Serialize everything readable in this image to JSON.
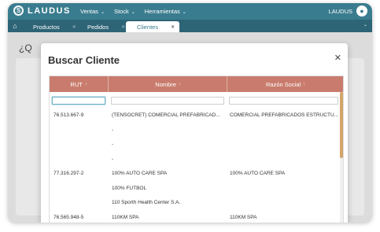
{
  "app": {
    "logo_text": "LAUDUS",
    "logo_mark": "S"
  },
  "menu": [
    {
      "label": "Ventas"
    },
    {
      "label": "Stock"
    },
    {
      "label": "Herramientas"
    }
  ],
  "user": {
    "name": "LAUDUS"
  },
  "tabs": [
    {
      "label": "Productos"
    },
    {
      "label": "Pedidos"
    },
    {
      "label": "Clientes"
    }
  ],
  "page": {
    "title": "¿Q"
  },
  "modal": {
    "title": "Buscar Cliente",
    "close_label": "✕",
    "columns": [
      "RUT",
      "Nombre",
      "Razón Social"
    ],
    "rows": [
      {
        "rut": "76.513.667-9",
        "nombre": "(TENSOCRET) COMERCIAL PREFABRICAD...",
        "razon": "COMERCIAL PREFABRICADOS ESTRUCTU..."
      },
      {
        "rut": "",
        "nombre": "-",
        "razon": ""
      },
      {
        "rut": "",
        "nombre": "-",
        "razon": ""
      },
      {
        "rut": "",
        "nombre": "-",
        "razon": ""
      },
      {
        "rut": "77.316.297-2",
        "nombre": "100% AUTO CARE SPA",
        "razon": "100% AUTO CARE SPA"
      },
      {
        "rut": "",
        "nombre": "100% FUTBOL",
        "razon": ""
      },
      {
        "rut": "",
        "nombre": "110 Sporth Health Center S.A.",
        "razon": ""
      },
      {
        "rut": "76.565.948-5",
        "nombre": "110KM SPA",
        "razon": "110KM SPA"
      }
    ]
  },
  "colors": {
    "topbar": "#3a7c8f",
    "tabbar": "#2d6476",
    "grid_header": "#c97c6d",
    "scroll_thumb": "#d4a46a"
  }
}
